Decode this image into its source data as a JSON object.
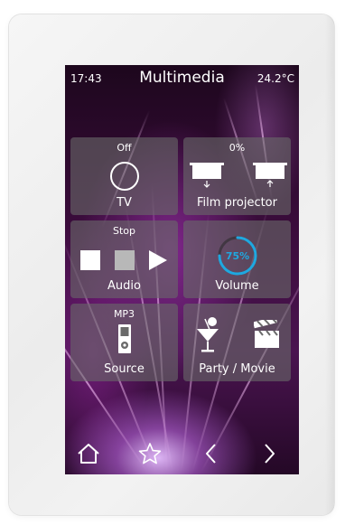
{
  "status_bar": {
    "time": "17:43",
    "title": "Multimedia",
    "temperature": "24.2°C"
  },
  "tiles": {
    "tv": {
      "state": "Off",
      "label": "TV",
      "icon": "circle-power-icon"
    },
    "projector": {
      "state": "0%",
      "label": "Film projector",
      "icons": [
        "screen-down-icon",
        "screen-up-icon"
      ]
    },
    "audio": {
      "state": "Stop",
      "label": "Audio",
      "icons": [
        "stop-icon",
        "pause-icon",
        "play-icon"
      ]
    },
    "volume": {
      "value": "75%",
      "level": 0.75,
      "label": "Volume",
      "accent": "#1fa8e0"
    },
    "source": {
      "state": "MP3",
      "label": "Source",
      "icon": "mp3-player-icon"
    },
    "party_movie": {
      "label": "Party / Movie",
      "icons": [
        "cocktail-icon",
        "clapperboard-icon"
      ]
    }
  },
  "nav": {
    "items": [
      "home-icon",
      "favorite-star-icon",
      "previous-icon",
      "next-icon"
    ]
  }
}
